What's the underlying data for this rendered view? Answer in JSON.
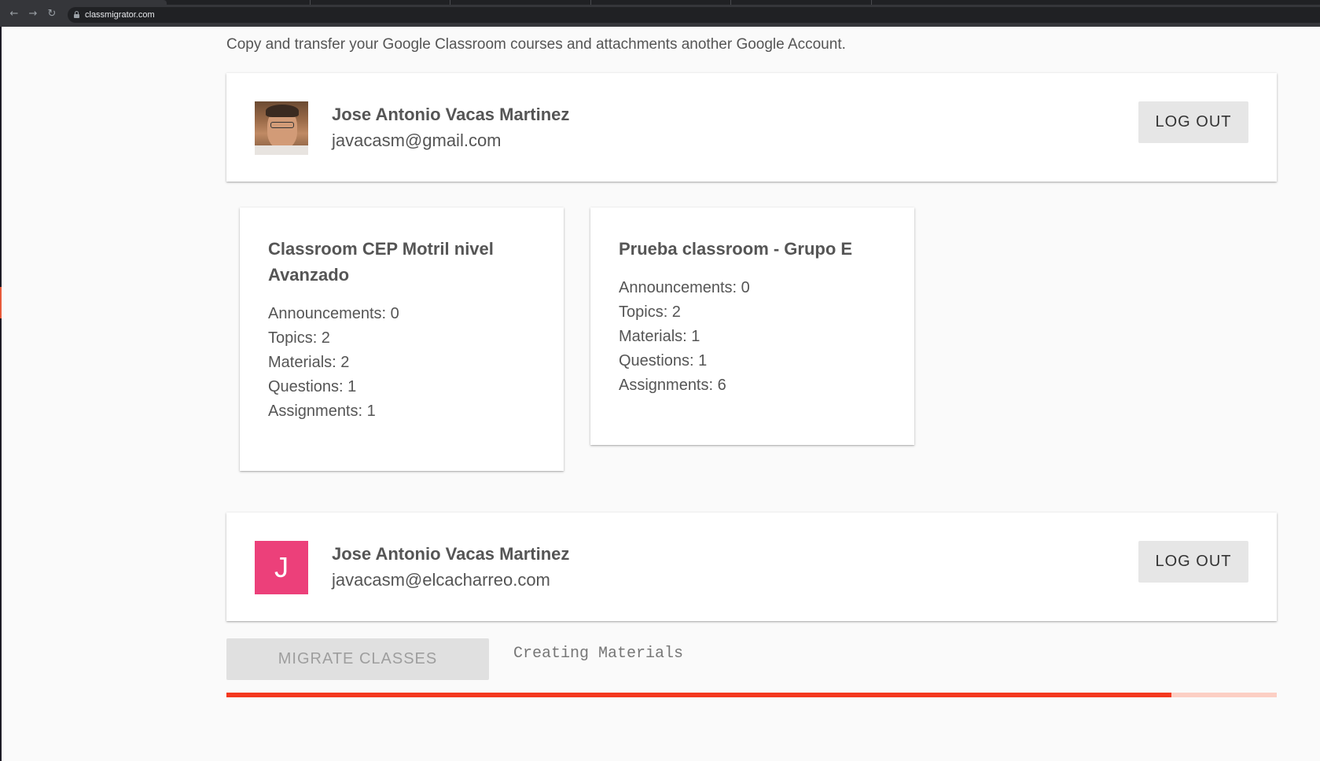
{
  "browser": {
    "url": "classmigrator.com"
  },
  "subtitle": "Copy and transfer your Google Classroom courses and attachments another Google Account.",
  "source_account": {
    "name": "Jose Antonio Vacas Martinez",
    "email": "javacasm@gmail.com",
    "logout_label": "LOG OUT"
  },
  "classes": [
    {
      "title": "Classroom CEP Motril nivel Avanzado",
      "stats": [
        "Announcements: 0",
        "Topics: 2",
        "Materials: 2",
        "Questions: 1",
        "Assignments: 1"
      ]
    },
    {
      "title": "Prueba classroom - Grupo E",
      "stats": [
        "Announcements: 0",
        "Topics: 2",
        "Materials: 1",
        "Questions: 1",
        "Assignments: 6"
      ]
    }
  ],
  "target_account": {
    "name": "Jose Antonio Vacas Martinez",
    "email": "javacasm@elcacharreo.com",
    "avatar_letter": "J",
    "avatar_color": "#ec407a",
    "logout_label": "LOG OUT"
  },
  "migrate": {
    "button_label": "MIGRATE CLASSES",
    "status": "Creating Materials",
    "progress": 0.9
  },
  "colors": {
    "progress_fill": "#f4381e",
    "progress_track": "#fccfc4"
  }
}
